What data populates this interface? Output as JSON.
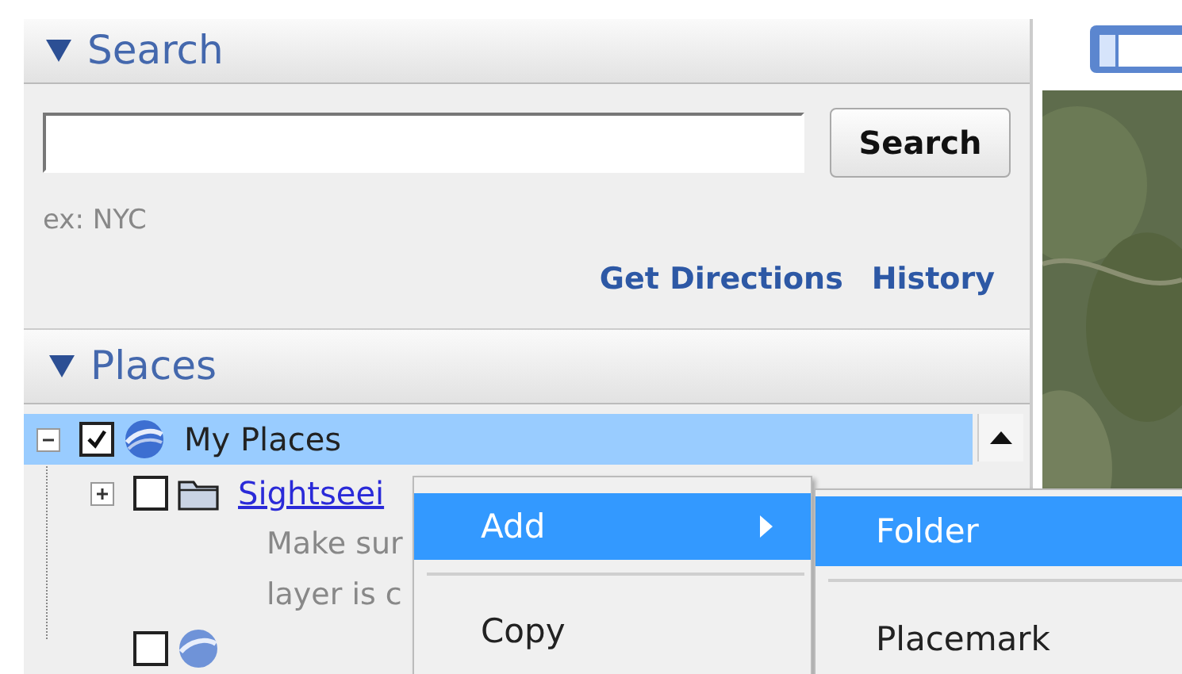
{
  "search": {
    "title": "Search",
    "expanded": true,
    "button": "Search",
    "hint": "ex: NYC",
    "links": [
      "Get Directions",
      "History"
    ]
  },
  "places": {
    "title": "Places",
    "expanded": true,
    "items": [
      {
        "label": "My Places",
        "kind": "globe",
        "checked": true,
        "selected": true,
        "expanded": true,
        "children": [
          {
            "label": "Sightseei",
            "kind": "folder",
            "checked": false,
            "selected": false,
            "expanded": false,
            "description": [
              "Make sur",
              "layer is c"
            ]
          },
          {
            "kind": "globe",
            "checked": false,
            "selected": false
          }
        ]
      }
    ]
  },
  "context_menu": {
    "items": [
      {
        "label": "Add",
        "selected": true,
        "submenu": true
      },
      {
        "label": "Copy",
        "selected": false,
        "submenu": false
      }
    ]
  },
  "submenu": {
    "items": [
      {
        "label": "Folder",
        "selected": true
      },
      {
        "label": "Placemark",
        "selected": false
      }
    ]
  }
}
